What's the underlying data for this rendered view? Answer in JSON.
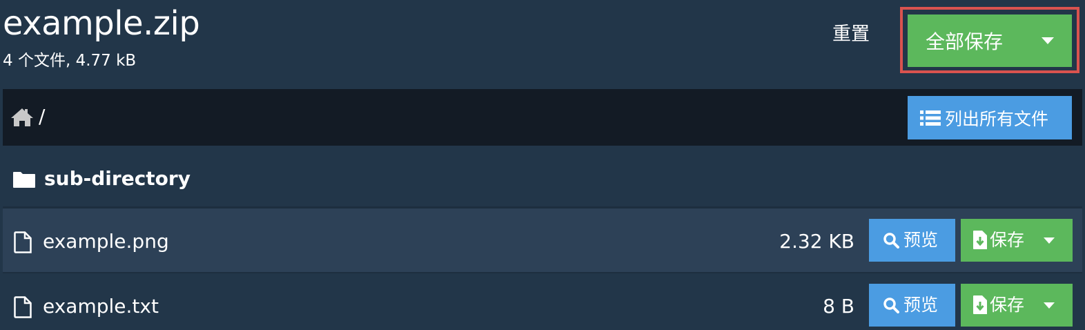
{
  "header": {
    "title": "example.zip",
    "summary": "4 个文件, 4.77 kB",
    "reset_label": "重置",
    "save_all_label": "全部保存"
  },
  "breadcrumb": {
    "path": "/",
    "list_all_label": "列出所有文件"
  },
  "directory": {
    "name": "sub-directory"
  },
  "files": [
    {
      "name": "example.png",
      "size": "2.32 KB",
      "preview_label": "预览",
      "save_label": "保存"
    },
    {
      "name": "example.txt",
      "size": "8 B",
      "preview_label": "预览",
      "save_label": "保存"
    }
  ],
  "colors": {
    "background": "#223649",
    "breadcrumb_bar": "#131b25",
    "row_highlight": "#2d4157",
    "primary_blue": "#4b9ce2",
    "success_green": "#5cb85c",
    "highlight_red": "#d9534f"
  },
  "icons": {
    "home": "home-icon",
    "list": "list-icon",
    "folder": "folder-icon",
    "file": "file-icon",
    "search": "search-icon",
    "download": "download-icon",
    "caret": "caret-down-icon"
  }
}
